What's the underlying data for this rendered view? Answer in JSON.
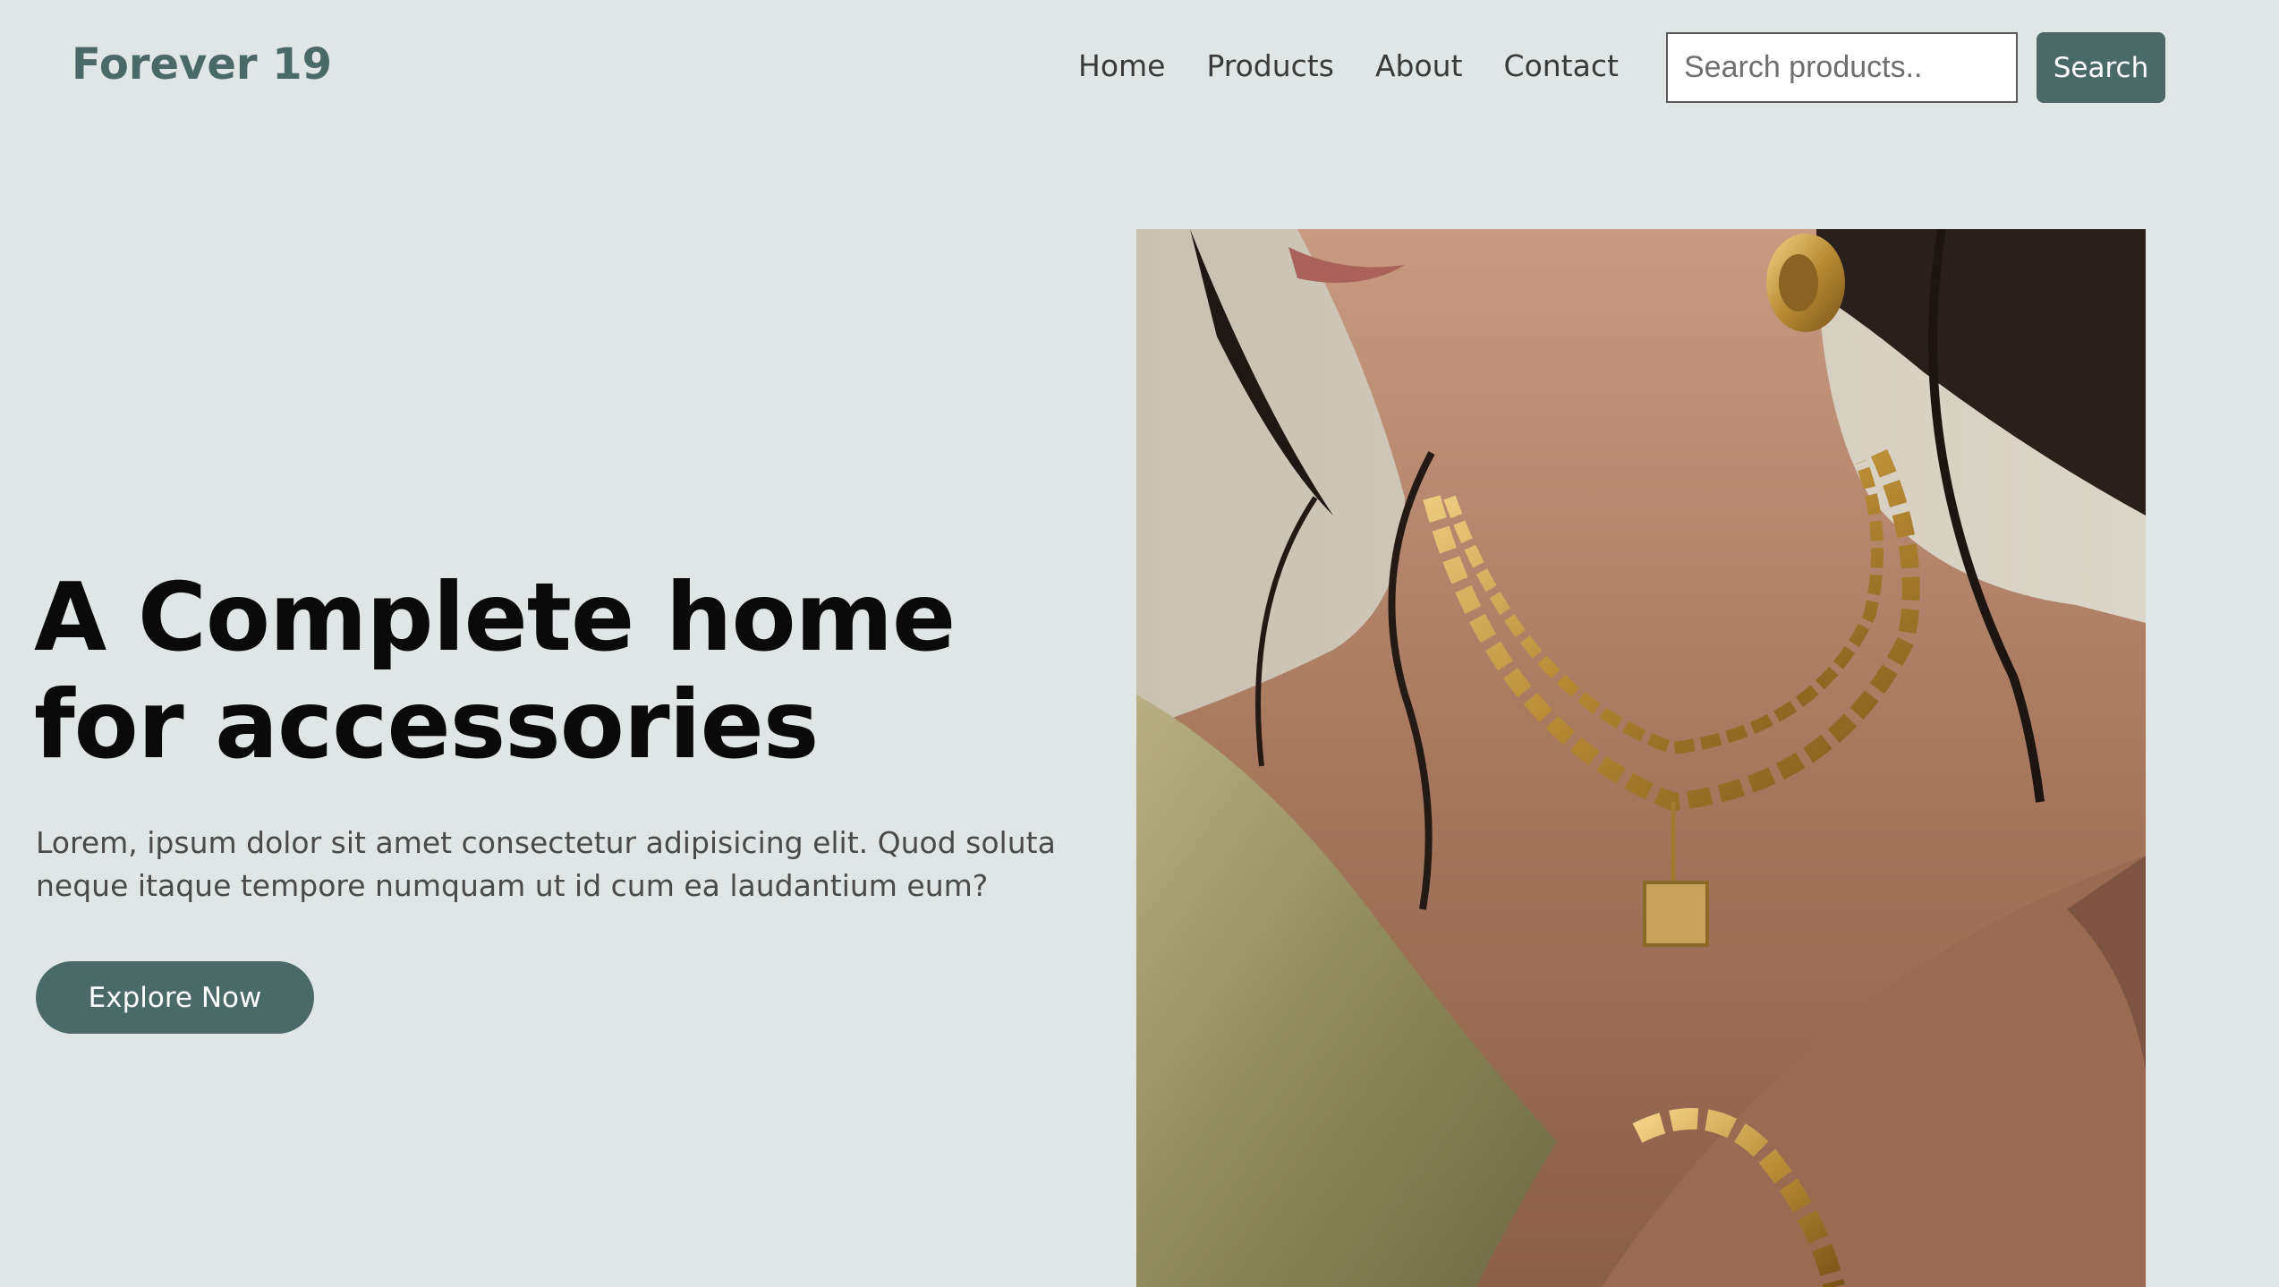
{
  "header": {
    "logo": "Forever 19",
    "nav": [
      "Home",
      "Products",
      "About",
      "Contact"
    ],
    "search_placeholder": "Search products..",
    "search_button": "Search"
  },
  "hero": {
    "title": "A Complete home for accessories",
    "text": "Lorem, ipsum dolor sit amet consectetur adipisicing elit. Quod soluta neque itaque tempore numquam ut id cum ea laudantium eum?",
    "cta": "Explore Now",
    "image_subject": "woman wearing gold chain necklaces, pendant, earring and bracelet"
  },
  "colors": {
    "background": "#dfe6e5",
    "accent": "#4a6a68",
    "heading": "#0a0a0a",
    "body_text": "#4a4a4a"
  }
}
